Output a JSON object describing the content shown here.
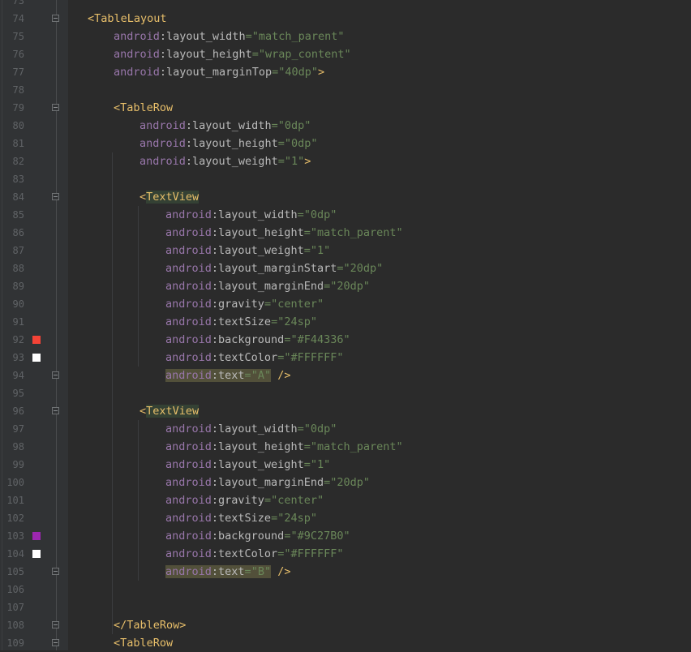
{
  "editor": {
    "colors": {
      "background": "#2b2b2b",
      "gutter": "#313335",
      "tag": "#e8bf6a",
      "namespace": "#9876aa",
      "attribute": "#bababa",
      "value": "#6a8759"
    },
    "lines": [
      {
        "num": "73",
        "indent": 0,
        "kind": "blank"
      },
      {
        "num": "74",
        "indent": 0,
        "kind": "open",
        "tag": "<TableLayout",
        "fold": true
      },
      {
        "num": "75",
        "indent": 1,
        "kind": "attr",
        "ns": "android",
        "name": "layout_width",
        "value": "\"match_parent\""
      },
      {
        "num": "76",
        "indent": 1,
        "kind": "attr",
        "ns": "android",
        "name": "layout_height",
        "value": "\"wrap_content\""
      },
      {
        "num": "77",
        "indent": 1,
        "kind": "attr",
        "ns": "android",
        "name": "layout_marginTop",
        "value": "\"40dp\"",
        "close": ">"
      },
      {
        "num": "78",
        "indent": 0,
        "kind": "blank"
      },
      {
        "num": "79",
        "indent": 1,
        "kind": "open",
        "tag": "<TableRow",
        "fold": true
      },
      {
        "num": "80",
        "indent": 2,
        "kind": "attr",
        "ns": "android",
        "name": "layout_width",
        "value": "\"0dp\""
      },
      {
        "num": "81",
        "indent": 2,
        "kind": "attr",
        "ns": "android",
        "name": "layout_height",
        "value": "\"0dp\""
      },
      {
        "num": "82",
        "indent": 2,
        "kind": "attr",
        "ns": "android",
        "name": "layout_weight",
        "value": "\"1\"",
        "close": ">"
      },
      {
        "num": "83",
        "indent": 0,
        "kind": "blank"
      },
      {
        "num": "84",
        "indent": 2,
        "kind": "open",
        "tag": "<",
        "tagname": "TextView",
        "fold": true,
        "highlight": true
      },
      {
        "num": "85",
        "indent": 3,
        "kind": "attr",
        "ns": "android",
        "name": "layout_width",
        "value": "\"0dp\""
      },
      {
        "num": "86",
        "indent": 3,
        "kind": "attr",
        "ns": "android",
        "name": "layout_height",
        "value": "\"match_parent\""
      },
      {
        "num": "87",
        "indent": 3,
        "kind": "attr",
        "ns": "android",
        "name": "layout_weight",
        "value": "\"1\""
      },
      {
        "num": "88",
        "indent": 3,
        "kind": "attr",
        "ns": "android",
        "name": "layout_marginStart",
        "value": "\"20dp\""
      },
      {
        "num": "89",
        "indent": 3,
        "kind": "attr",
        "ns": "android",
        "name": "layout_marginEnd",
        "value": "\"20dp\""
      },
      {
        "num": "90",
        "indent": 3,
        "kind": "attr",
        "ns": "android",
        "name": "gravity",
        "value": "\"center\""
      },
      {
        "num": "91",
        "indent": 3,
        "kind": "attr",
        "ns": "android",
        "name": "textSize",
        "value": "\"24sp\""
      },
      {
        "num": "92",
        "indent": 3,
        "kind": "attr",
        "ns": "android",
        "name": "background",
        "value": "\"#F44336\"",
        "swatch": "#F44336"
      },
      {
        "num": "93",
        "indent": 3,
        "kind": "attr",
        "ns": "android",
        "name": "textColor",
        "value": "\"#FFFFFF\"",
        "swatch": "#FFFFFF"
      },
      {
        "num": "94",
        "indent": 3,
        "kind": "attr",
        "ns": "android",
        "name": "text",
        "value": "\"A\"",
        "close": " />",
        "fold": true,
        "highlight": true
      },
      {
        "num": "95",
        "indent": 0,
        "kind": "blank"
      },
      {
        "num": "96",
        "indent": 2,
        "kind": "open",
        "tag": "<",
        "tagname": "TextView",
        "fold": true,
        "highlight": true
      },
      {
        "num": "97",
        "indent": 3,
        "kind": "attr",
        "ns": "android",
        "name": "layout_width",
        "value": "\"0dp\""
      },
      {
        "num": "98",
        "indent": 3,
        "kind": "attr",
        "ns": "android",
        "name": "layout_height",
        "value": "\"match_parent\""
      },
      {
        "num": "99",
        "indent": 3,
        "kind": "attr",
        "ns": "android",
        "name": "layout_weight",
        "value": "\"1\""
      },
      {
        "num": "100",
        "indent": 3,
        "kind": "attr",
        "ns": "android",
        "name": "layout_marginEnd",
        "value": "\"20dp\""
      },
      {
        "num": "101",
        "indent": 3,
        "kind": "attr",
        "ns": "android",
        "name": "gravity",
        "value": "\"center\""
      },
      {
        "num": "102",
        "indent": 3,
        "kind": "attr",
        "ns": "android",
        "name": "textSize",
        "value": "\"24sp\""
      },
      {
        "num": "103",
        "indent": 3,
        "kind": "attr",
        "ns": "android",
        "name": "background",
        "value": "\"#9C27B0\"",
        "swatch": "#9C27B0"
      },
      {
        "num": "104",
        "indent": 3,
        "kind": "attr",
        "ns": "android",
        "name": "textColor",
        "value": "\"#FFFFFF\"",
        "swatch": "#FFFFFF"
      },
      {
        "num": "105",
        "indent": 3,
        "kind": "attr",
        "ns": "android",
        "name": "text",
        "value": "\"B\"",
        "close": " />",
        "fold": true,
        "highlight": true
      },
      {
        "num": "106",
        "indent": 0,
        "kind": "blank"
      },
      {
        "num": "107",
        "indent": 0,
        "kind": "blank"
      },
      {
        "num": "108",
        "indent": 1,
        "kind": "open",
        "tag": "</TableRow>",
        "fold": true
      },
      {
        "num": "109",
        "indent": 1,
        "kind": "open",
        "tag": "<TableRow",
        "fold": true
      }
    ]
  }
}
